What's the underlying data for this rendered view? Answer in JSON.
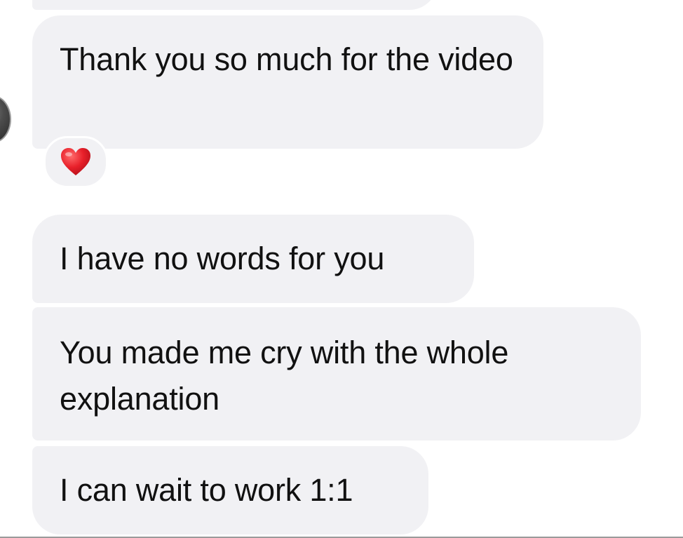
{
  "messages": [
    {
      "text": ""
    },
    {
      "text": "Thank you so much for the video"
    },
    {
      "text": "I have no words for you"
    },
    {
      "text": "You made me cry with the whole explanation"
    },
    {
      "text": "I can wait to work 1:1"
    }
  ],
  "reaction": {
    "icon": "heart-icon",
    "emoji": "❤️",
    "color": "#e8202a"
  },
  "colors": {
    "bubble": "#f1f1f4",
    "text": "#111111",
    "background": "#ffffff"
  }
}
